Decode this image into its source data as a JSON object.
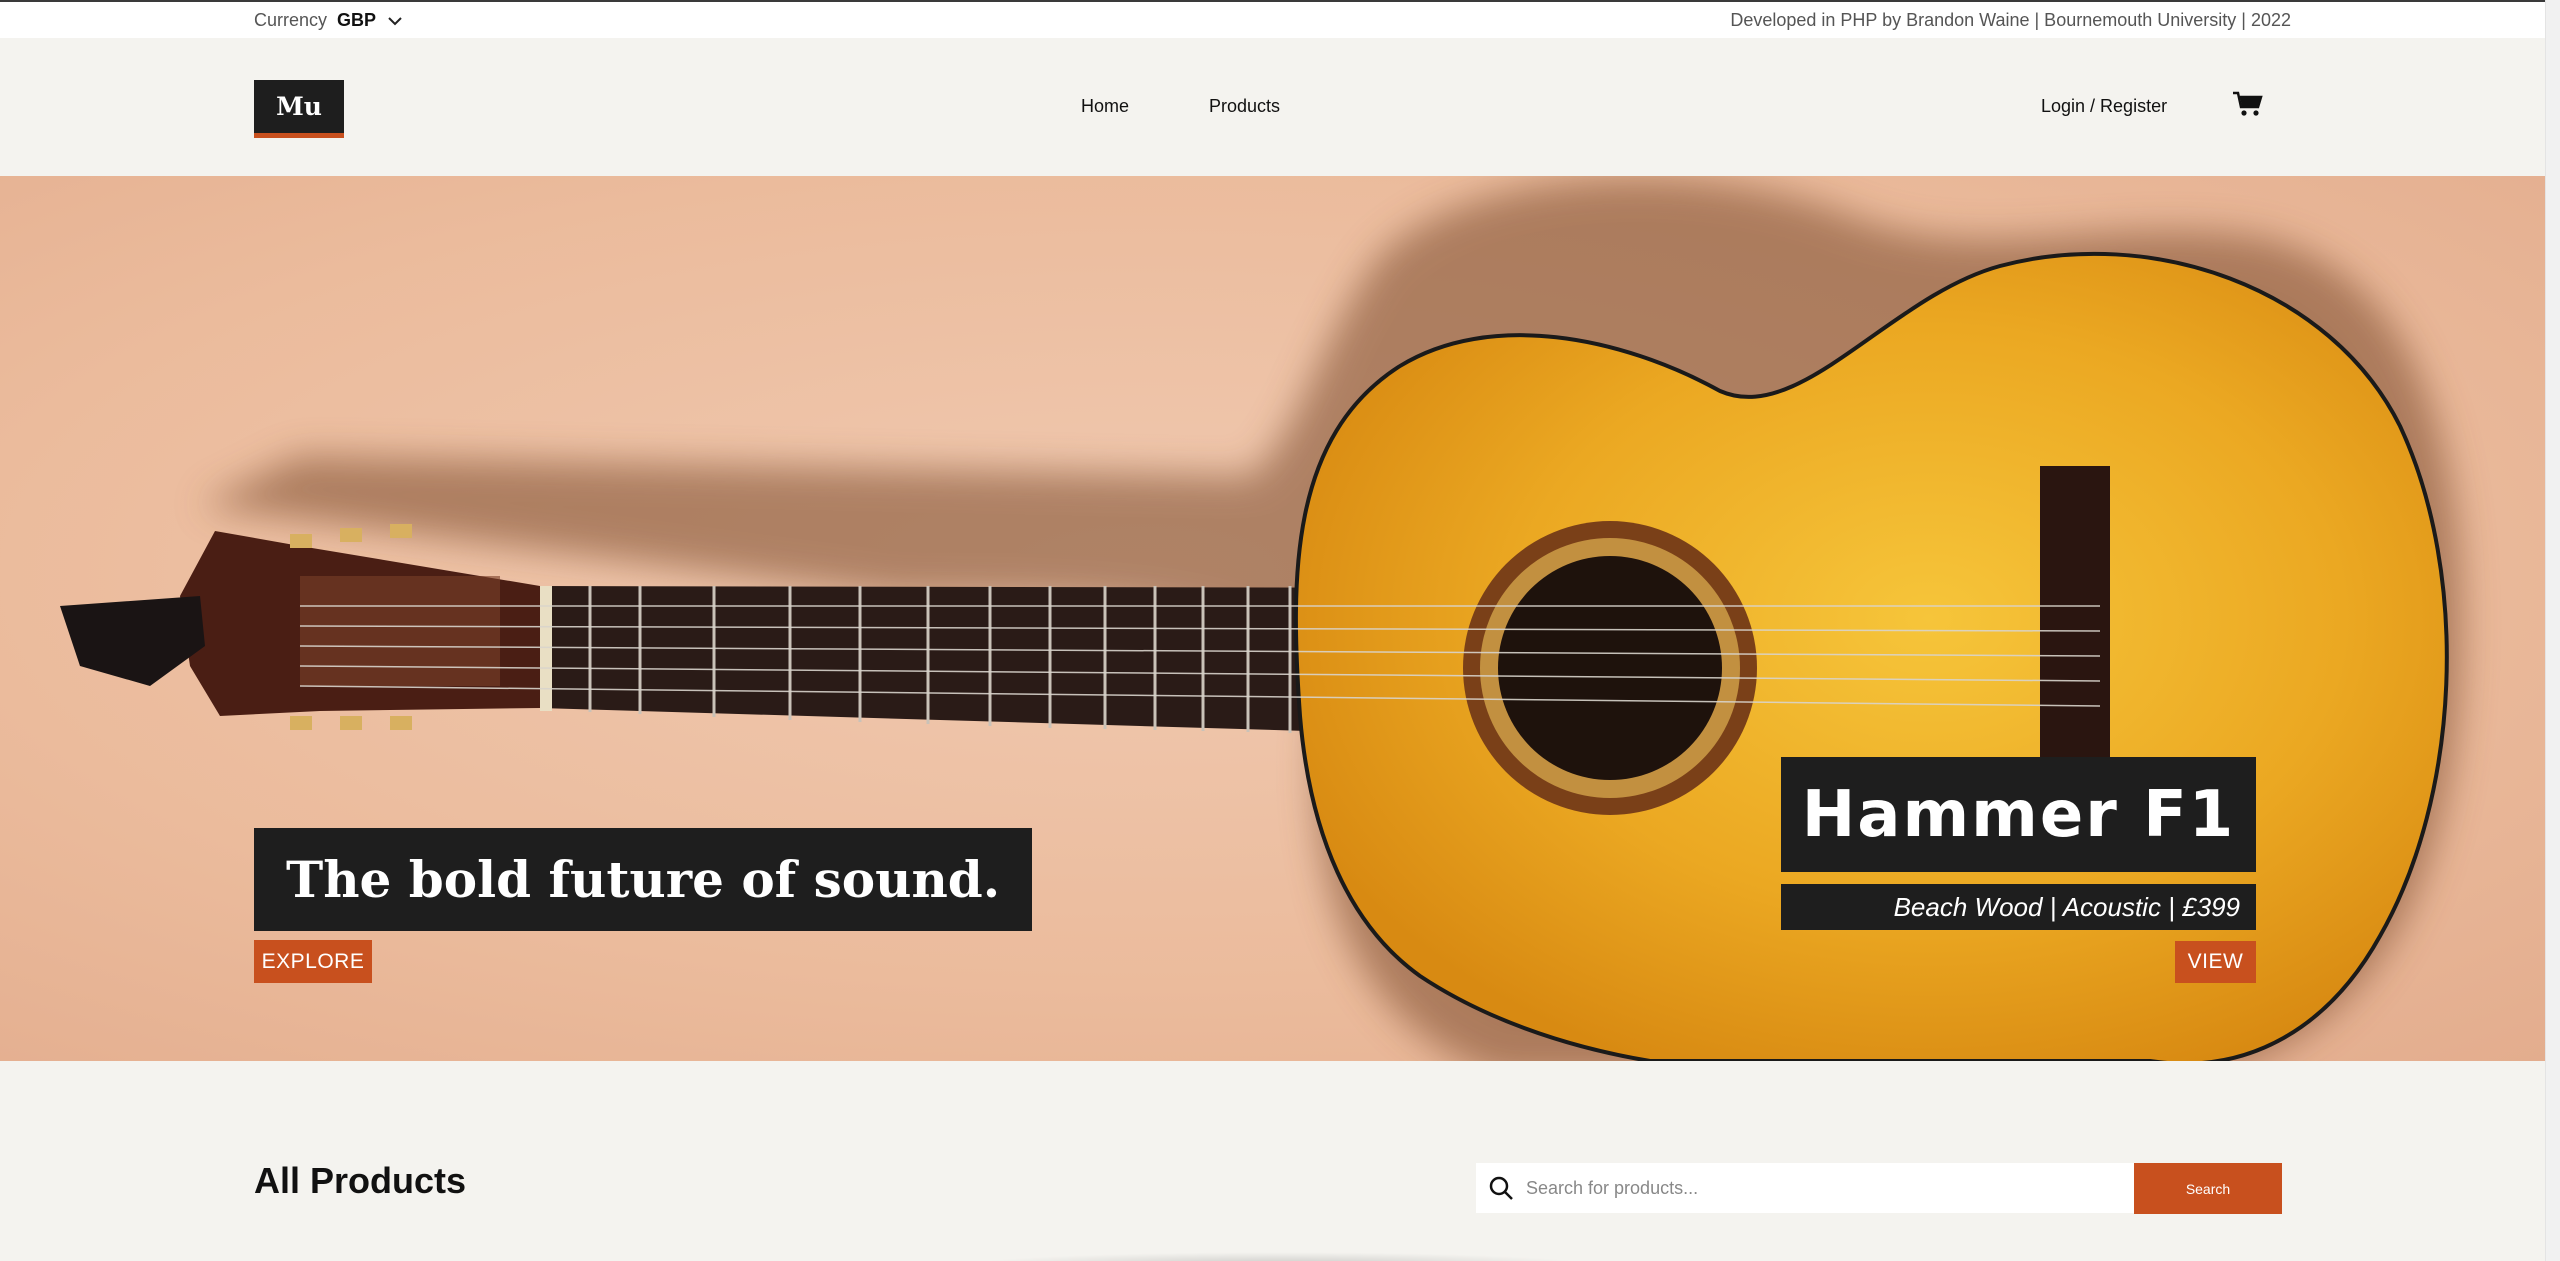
{
  "topbar": {
    "currency_label": "Currency",
    "currency_value": "GBP",
    "credits": "Developed in PHP by Brandon Waine | Bournemouth University | 2022"
  },
  "header": {
    "logo": "Mu",
    "nav": {
      "home": "Home",
      "products": "Products"
    },
    "login": "Login / Register"
  },
  "hero": {
    "tagline": "The bold future of sound.",
    "explore_label": "EXPLORE",
    "product_name": "Hammer F1",
    "product_details": "Beach Wood | Acoustic | £399",
    "view_label": "VIEW"
  },
  "products": {
    "heading": "All Products",
    "search_placeholder": "Search for products...",
    "search_button": "Search"
  },
  "colors": {
    "accent": "#c8501e",
    "dark": "#1e1e1e",
    "page_bg": "#f4f3ef"
  },
  "icons": [
    "chevron-down-icon",
    "cart-icon",
    "search-icon"
  ]
}
